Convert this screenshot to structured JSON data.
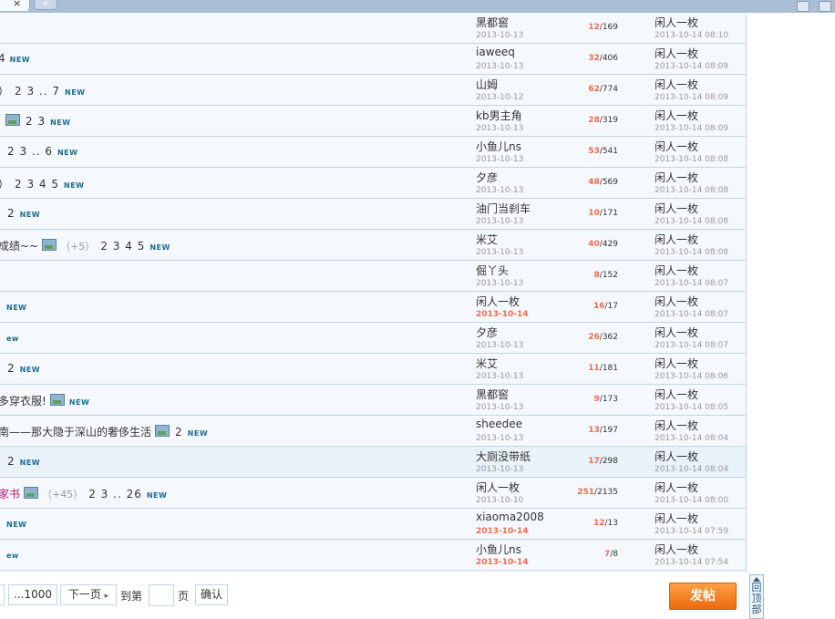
{
  "browser": {
    "tab_close": "×",
    "tab_new": "+"
  },
  "threads": [
    {
      "title": "",
      "author": "黑都窖",
      "author_date": "2013-10-13",
      "replies": "12",
      "views": "169",
      "last_poster": "闲人一枚",
      "last_date": "2013-10-14 08:10"
    },
    {
      "title": "4",
      "new": "NEW",
      "author": "iaweeq",
      "author_date": "2013-10-13",
      "replies": "32",
      "views": "406",
      "last_poster": "闲人一枚",
      "last_date": "2013-10-14 08:09"
    },
    {
      "title": "）",
      "pages": "2 3 .. 7",
      "new": "NEW",
      "author": "山姆",
      "author_date": "2013-10-12",
      "replies": "62",
      "views": "774",
      "last_poster": "闲人一枚",
      "last_date": "2013-10-14 08:09"
    },
    {
      "title": "",
      "image": true,
      "pages": "2 3",
      "new": "NEW",
      "author": "kb男主角",
      "author_date": "2013-10-13",
      "replies": "28",
      "views": "319",
      "last_poster": "闲人一枚",
      "last_date": "2013-10-14 08:09"
    },
    {
      "title": "",
      "pages": "2 3 .. 6",
      "new": "NEW",
      "author": "小鱼儿ns",
      "author_date": "2013-10-13",
      "replies": "53",
      "views": "541",
      "last_poster": "闲人一枚",
      "last_date": "2013-10-14 08:08"
    },
    {
      "title": "）",
      "pages": "2 3 4 5",
      "new": "NEW",
      "author": "夕彦",
      "author_date": "2013-10-13",
      "replies": "48",
      "views": "569",
      "last_poster": "闲人一枚",
      "last_date": "2013-10-14 08:08"
    },
    {
      "title": "",
      "pages": "2",
      "new": "NEW",
      "author": "油门当刹车",
      "author_date": "2013-10-13",
      "replies": "10",
      "views": "171",
      "last_poster": "闲人一枚",
      "last_date": "2013-10-14 08:08"
    },
    {
      "title": "成绩~~",
      "image": true,
      "plus": "（+5）",
      "pages": "2 3 4 5",
      "new": "NEW",
      "author": "米艾",
      "author_date": "2013-10-13",
      "replies": "40",
      "views": "429",
      "last_poster": "闲人一枚",
      "last_date": "2013-10-14 08:08"
    },
    {
      "title": "",
      "author": "倔丫头",
      "author_date": "2013-10-13",
      "replies": "8",
      "views": "152",
      "last_poster": "闲人一枚",
      "last_date": "2013-10-14 08:07"
    },
    {
      "title": "",
      "new": "NEW",
      "author": "闲人一枚",
      "author_date": "2013-10-14",
      "author_date_new": true,
      "replies": "16",
      "views": "17",
      "last_poster": "闲人一枚",
      "last_date": "2013-10-14 08:07"
    },
    {
      "title": "",
      "new": "ew",
      "author": "夕彦",
      "author_date": "2013-10-13",
      "replies": "26",
      "views": "362",
      "last_poster": "闲人一枚",
      "last_date": "2013-10-14 08:07"
    },
    {
      "title": "",
      "pages": "2",
      "new": "NEW",
      "author": "米艾",
      "author_date": "2013-10-13",
      "replies": "11",
      "views": "181",
      "last_poster": "闲人一枚",
      "last_date": "2013-10-14 08:06"
    },
    {
      "title": "多穿衣服!",
      "image": true,
      "new": "NEW",
      "author": "黑都窖",
      "author_date": "2013-10-13",
      "replies": "9",
      "views": "173",
      "last_poster": "闲人一枚",
      "last_date": "2013-10-14 08:05"
    },
    {
      "title": "南——那大隐于深山的奢侈生活",
      "image": true,
      "pages": "2",
      "new": "NEW",
      "author": "sheedee",
      "author_date": "2013-10-13",
      "replies": "13",
      "views": "197",
      "last_poster": "闲人一枚",
      "last_date": "2013-10-14 08:04"
    },
    {
      "title": "",
      "pages": "2",
      "new": "NEW",
      "author": "大厕没带纸",
      "author_date": "2013-10-13",
      "replies": "17",
      "views": "298",
      "last_poster": "闲人一枚",
      "last_date": "2013-10-14 08:04",
      "highlight": true
    },
    {
      "title": "家书",
      "title_red": true,
      "image": true,
      "plus": "（+45）",
      "pages": "2 3 .. 26",
      "new": "NEW",
      "author": "闲人一枚",
      "author_date": "2013-10-10",
      "replies": "251",
      "views": "2135",
      "last_poster": "闲人一枚",
      "last_date": "2013-10-14 08:00"
    },
    {
      "title": "",
      "new": "NEW",
      "author": "xiaoma2008",
      "author_date": "2013-10-14",
      "author_date_new": true,
      "replies": "12",
      "views": "13",
      "last_poster": "闲人一枚",
      "last_date": "2013-10-14 07:59"
    },
    {
      "title": "",
      "new": "ew",
      "author": "小鱼儿ns",
      "author_date": "2013-10-14",
      "author_date_new": true,
      "replies": "7",
      "views": "8",
      "last_poster": "闲人一枚",
      "last_date": "2013-10-14 07:54"
    }
  ],
  "pager": {
    "last": "...1000",
    "next": "下一页",
    "next_arrow": "▸",
    "goto_label": "到第",
    "page_suffix": "页",
    "confirm": "确认",
    "input_value": ""
  },
  "post_button": "发帖",
  "back_to_top": "回顶部",
  "colors": {
    "accent": "#f26c4f",
    "link": "#1e6b91",
    "border": "#c2d5e3",
    "post_button": "#ea6b0e"
  }
}
